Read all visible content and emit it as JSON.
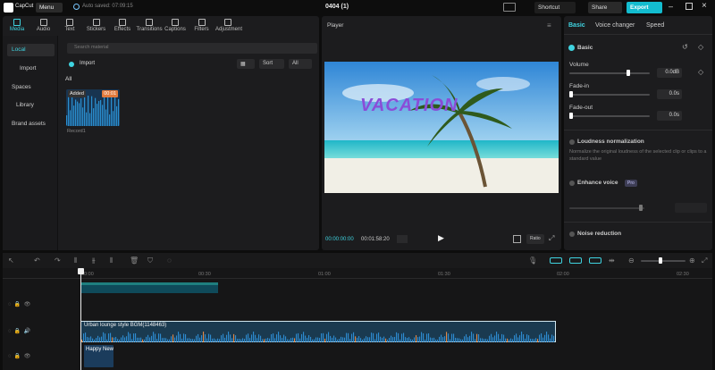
{
  "topbar": {
    "logo_text": "CapCut",
    "menu_label": "Menu",
    "autosave": "Auto saved: 07:09:15",
    "project_title": "0404 (1)",
    "shortcut_label": "Shortcut",
    "share_label": "Share",
    "export_label": "Export"
  },
  "toolbar_tabs": [
    {
      "label": "Media",
      "icon": "media-icon"
    },
    {
      "label": "Audio",
      "icon": "audio-icon"
    },
    {
      "label": "Text",
      "icon": "text-icon"
    },
    {
      "label": "Stickers",
      "icon": "stickers-icon"
    },
    {
      "label": "Effects",
      "icon": "effects-icon"
    },
    {
      "label": "Transitions",
      "icon": "transitions-icon"
    },
    {
      "label": "Captions",
      "icon": "captions-icon"
    },
    {
      "label": "Filters",
      "icon": "filters-icon"
    },
    {
      "label": "Adjustment",
      "icon": "adjustment-icon"
    }
  ],
  "media_sidebar": [
    "Local",
    "Import",
    "Spaces",
    "Library",
    "Brand assets"
  ],
  "media": {
    "search_placeholder": "Search material",
    "import_label": "Import",
    "sort_label": "Sort",
    "filter_label": "All",
    "section_label": "All",
    "item": {
      "badge": "Added",
      "duration": "00:01",
      "name": "Record1"
    }
  },
  "player": {
    "title": "Player",
    "overlay_text": "VACATION",
    "current_time": "00:00:00:00",
    "total_time": "00:01:58:20",
    "ratio_label": "Ratio"
  },
  "properties": {
    "tabs": [
      "Basic",
      "Voice changer",
      "Speed"
    ],
    "section": "Basic",
    "volume_label": "Volume",
    "volume_value": "0.0dB",
    "fade_in_label": "Fade-in",
    "fade_in_value": "0.0s",
    "fade_out_label": "Fade-out",
    "fade_out_value": "0.0s",
    "loudness_label": "Loudness normalization",
    "loudness_desc": "Normalize the original loudness of the selected clip or clips to a standard value",
    "enhance_label": "Enhance voice",
    "enhance_badge": "Pro",
    "noise_label": "Noise reduction",
    "accent": "#3fd3e0"
  },
  "timeline": {
    "ruler": [
      "00:00",
      "00:30",
      "01:00",
      "01:30",
      "02:00",
      "02:30"
    ],
    "audio_clip_name": "Urban lounge style BGM(1148463)",
    "text_clip_name": "Happy New"
  }
}
